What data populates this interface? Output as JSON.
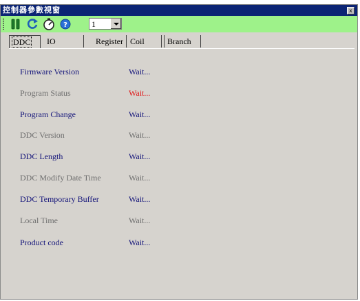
{
  "window": {
    "title": "控制器參數視窗",
    "close_label": "x"
  },
  "toolbar": {
    "icons": [
      "pause-icon",
      "refresh-icon",
      "gauge-icon",
      "info-icon"
    ],
    "select_value": "1"
  },
  "tabs": [
    {
      "label": "DDC",
      "active": true
    },
    {
      "label": "IO"
    },
    {
      "label": "Register"
    },
    {
      "label": "Coil"
    },
    {
      "label": "Branch"
    }
  ],
  "rows": [
    {
      "label": "Firmware Version",
      "value": "Wait...",
      "label_color": "#14147a",
      "value_color": "#14147a"
    },
    {
      "label": "Program Status",
      "value": "Wait...",
      "label_color": "#6e6e6e",
      "value_color": "#e01818"
    },
    {
      "label": "Program Change",
      "value": "Wait...",
      "label_color": "#14147a",
      "value_color": "#14147a"
    },
    {
      "label": "DDC Version",
      "value": "Wait...",
      "label_color": "#6e6e6e",
      "value_color": "#6e6e6e"
    },
    {
      "label": "DDC Length",
      "value": "Wait...",
      "label_color": "#14147a",
      "value_color": "#14147a"
    },
    {
      "label": "DDC Modify Date Time",
      "value": "Wait...",
      "label_color": "#6e6e6e",
      "value_color": "#6e6e6e"
    },
    {
      "label": "DDC Temporary Buffer",
      "value": "Wait...",
      "label_color": "#14147a",
      "value_color": "#14147a"
    },
    {
      "label": "Local Time",
      "value": "Wait...",
      "label_color": "#6e6e6e",
      "value_color": "#6e6e6e"
    },
    {
      "label": "Product code",
      "value": "Wait...",
      "label_color": "#14147a",
      "value_color": "#14147a"
    }
  ],
  "colors": {
    "titlebar": "#0b2474",
    "toolbar": "#9ef28a",
    "panel": "#d6d3ce"
  }
}
